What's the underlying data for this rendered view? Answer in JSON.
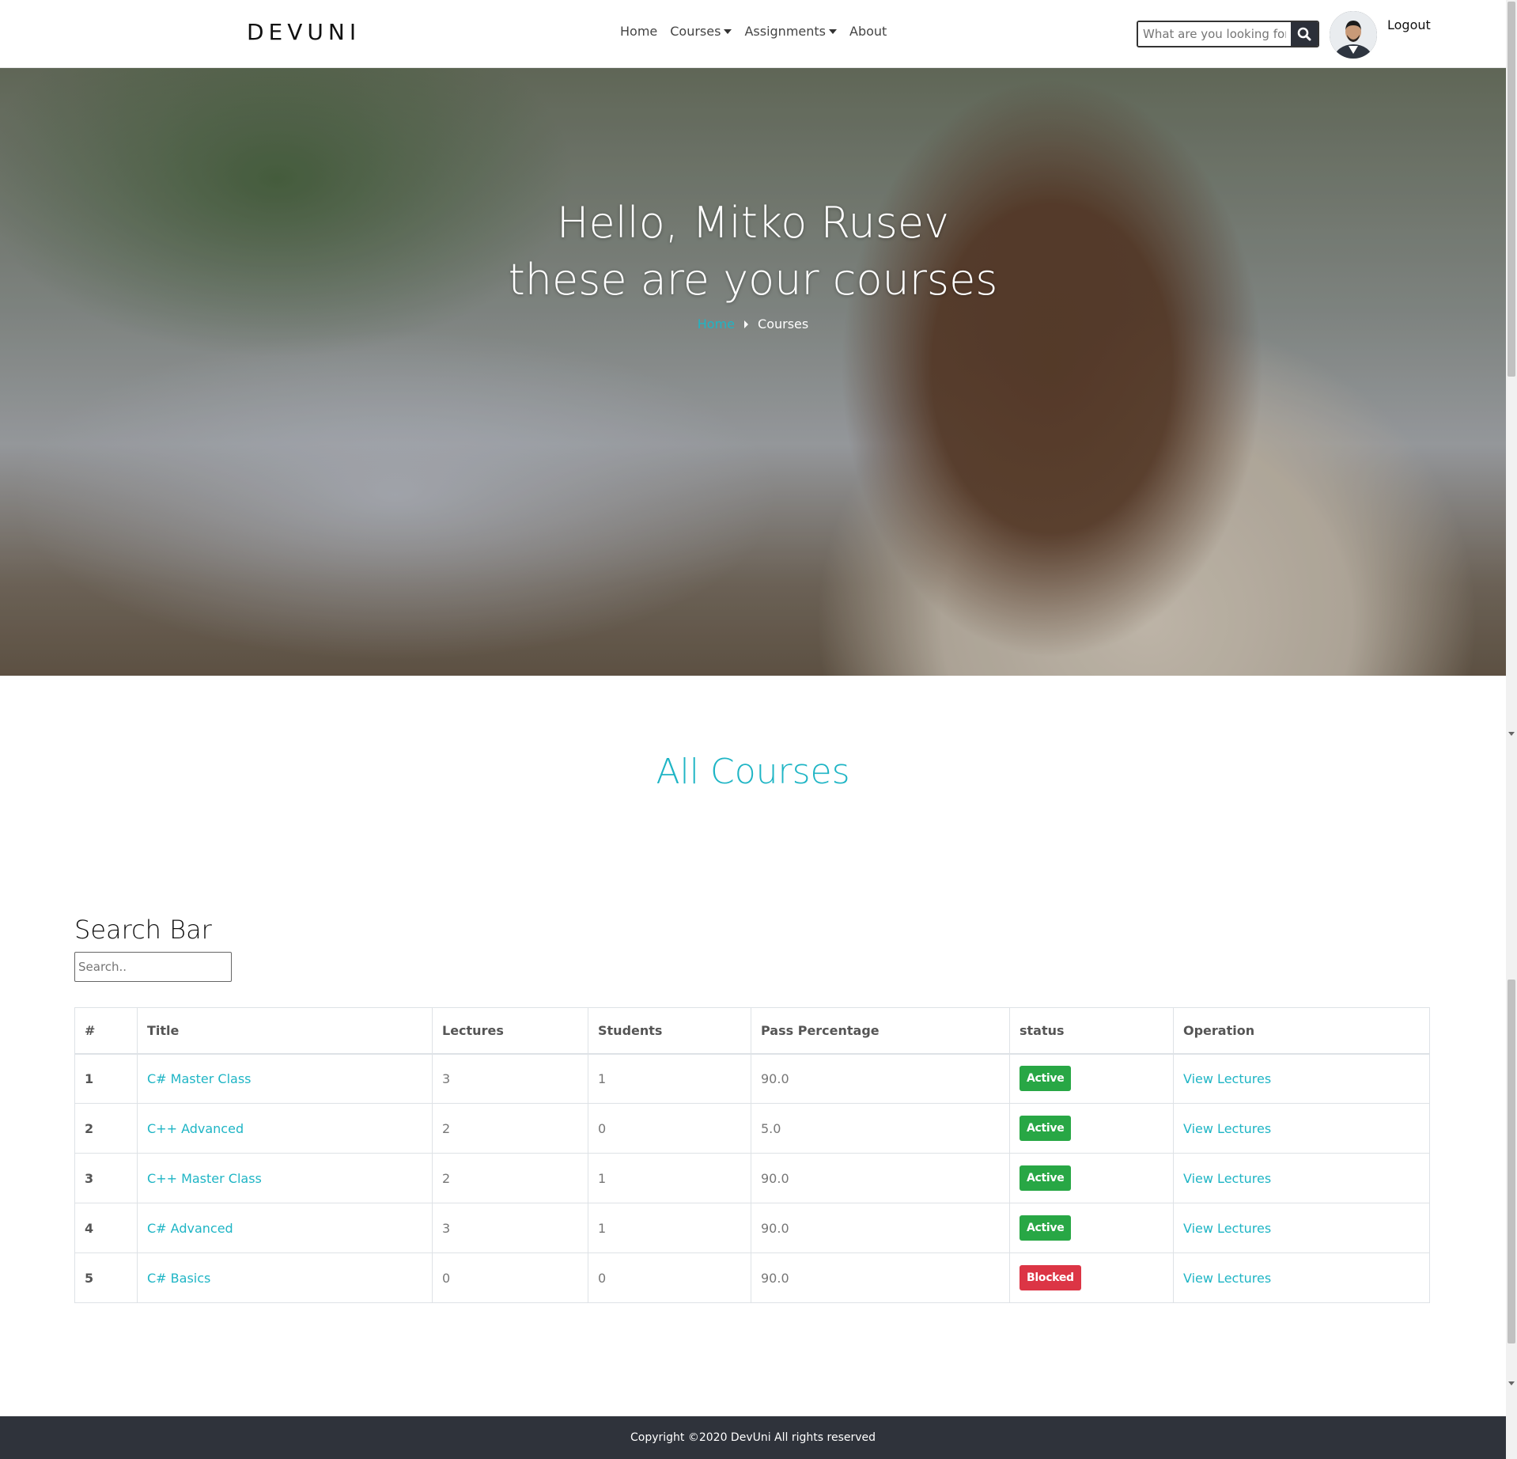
{
  "header": {
    "brand": "DEVUNI",
    "nav": [
      {
        "label": "Home",
        "dropdown": false
      },
      {
        "label": "Courses",
        "dropdown": true
      },
      {
        "label": "Assignments",
        "dropdown": true
      },
      {
        "label": "About",
        "dropdown": false
      }
    ],
    "search_placeholder": "What are you looking for",
    "logout_label": "Logout"
  },
  "hero": {
    "line1": "Hello, Mitko Rusev",
    "line2": "these are your courses",
    "breadcrumb_home": "Home",
    "breadcrumb_current": "Courses"
  },
  "section_title": "All Courses",
  "search_section": {
    "heading": "Search Bar",
    "placeholder": "Search.."
  },
  "table": {
    "columns": [
      "#",
      "Title",
      "Lectures",
      "Students",
      "Pass Percentage",
      "status",
      "Operation"
    ],
    "rows": [
      {
        "num": "1",
        "title": "C# Master Class",
        "lectures": "3",
        "students": "1",
        "pass": "90.0",
        "status": "Active",
        "operation": "View Lectures"
      },
      {
        "num": "2",
        "title": "C++ Advanced",
        "lectures": "2",
        "students": "0",
        "pass": "5.0",
        "status": "Active",
        "operation": "View Lectures"
      },
      {
        "num": "3",
        "title": "C++ Master Class",
        "lectures": "2",
        "students": "1",
        "pass": "90.0",
        "status": "Active",
        "operation": "View Lectures"
      },
      {
        "num": "4",
        "title": "C# Advanced",
        "lectures": "3",
        "students": "1",
        "pass": "90.0",
        "status": "Active",
        "operation": "View Lectures"
      },
      {
        "num": "5",
        "title": "C# Basics",
        "lectures": "0",
        "students": "0",
        "pass": "90.0",
        "status": "Blocked",
        "operation": "View Lectures"
      }
    ]
  },
  "footer": {
    "text": "Copyright ©2020 DevUni All rights reserved"
  },
  "colors": {
    "accent": "#1fb5c5",
    "active": "#28a745",
    "blocked": "#dc3545",
    "footer_bg": "#2f333b"
  }
}
